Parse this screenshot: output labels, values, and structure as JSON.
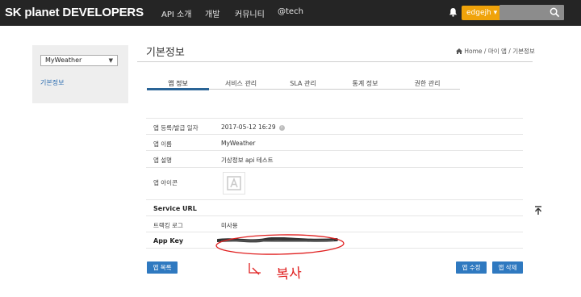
{
  "header": {
    "brand": "SK planet DEVELOPERS",
    "nav": [
      "API 소개",
      "개발",
      "커뮤니티",
      "@tech"
    ],
    "user": "edgejh",
    "search_placeholder": ""
  },
  "sidebar": {
    "selected_app": "MyWeather",
    "items": [
      {
        "label": "기본정보"
      }
    ]
  },
  "page": {
    "title": "기본정보",
    "breadcrumb": "Home / 마이 앱 / 기본정보"
  },
  "tabs": [
    {
      "label": "앱 정보",
      "active": true
    },
    {
      "label": "서비스 관리",
      "active": false
    },
    {
      "label": "SLA 관리",
      "active": false
    },
    {
      "label": "통계 정보",
      "active": false
    },
    {
      "label": "권한 관리",
      "active": false
    }
  ],
  "details": [
    {
      "label": "앱 등록/발급 일자",
      "value": "2017-05-12 16:29"
    },
    {
      "label": "앱 이름",
      "value": "MyWeather"
    },
    {
      "label": "앱 설명",
      "value": "기상정보 api 테스트"
    },
    {
      "label": "앱 아이콘",
      "value": ""
    },
    {
      "label": "Service URL",
      "value": ""
    },
    {
      "label": "트랙킹 로그",
      "value": "미사용"
    },
    {
      "label": "App Key",
      "value": ""
    }
  ],
  "buttons": {
    "list": "앱 목록",
    "edit": "앱 수정",
    "delete": "앱 삭제"
  },
  "annotation": {
    "handwritten_text": "복사",
    "color": "#e02020"
  },
  "colors": {
    "topbar": "#252525",
    "accent": "#2f79c0",
    "user_button": "#f0a30a"
  }
}
